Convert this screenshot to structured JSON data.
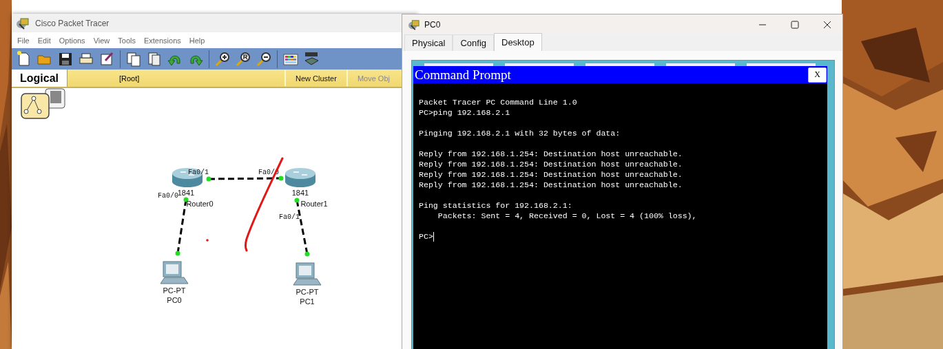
{
  "main_window": {
    "title": "Cisco Packet Tracer",
    "menu": [
      "File",
      "Edit",
      "Options",
      "View",
      "Tools",
      "Extensions",
      "Help"
    ],
    "workspace_bar": {
      "mode": "Logical",
      "path": "[Root]",
      "buttons": [
        "New Cluster",
        "Move Obj"
      ]
    },
    "devices": [
      {
        "kind": "router",
        "model": "1841",
        "name": "Router0"
      },
      {
        "kind": "router",
        "model": "1841",
        "name": "Router1"
      },
      {
        "kind": "pc",
        "model": "PC-PT",
        "name": "PC0"
      },
      {
        "kind": "pc",
        "model": "PC-PT",
        "name": "PC1"
      }
    ],
    "port_labels": [
      "Fa0/1",
      "Fa0/0",
      "Fa0/0",
      "Fa0/1"
    ],
    "links": [
      {
        "up": true
      },
      {
        "up": true
      },
      {
        "up": true
      }
    ]
  },
  "pc_window": {
    "title": "PC0",
    "tabs": [
      {
        "label": "Physical",
        "selected": false
      },
      {
        "label": "Config",
        "selected": false
      },
      {
        "label": "Desktop",
        "selected": true
      }
    ],
    "command_prompt": {
      "title": "Command Prompt",
      "close": "X",
      "blocks": [
        [
          "Packet Tracer PC Command Line 1.0",
          "PC>ping 192.168.2.1"
        ],
        [
          "Pinging 192.168.2.1 with 32 bytes of data:"
        ],
        [
          "Reply from 192.168.1.254: Destination host unreachable.",
          "Reply from 192.168.1.254: Destination host unreachable.",
          "Reply from 192.168.1.254: Destination host unreachable.",
          "Reply from 192.168.1.254: Destination host unreachable."
        ],
        [
          "Ping statistics for 192.168.2.1:",
          "    Packets: Sent = 4, Received = 0, Lost = 4 (100% loss),"
        ]
      ],
      "prompt": "PC>"
    }
  }
}
